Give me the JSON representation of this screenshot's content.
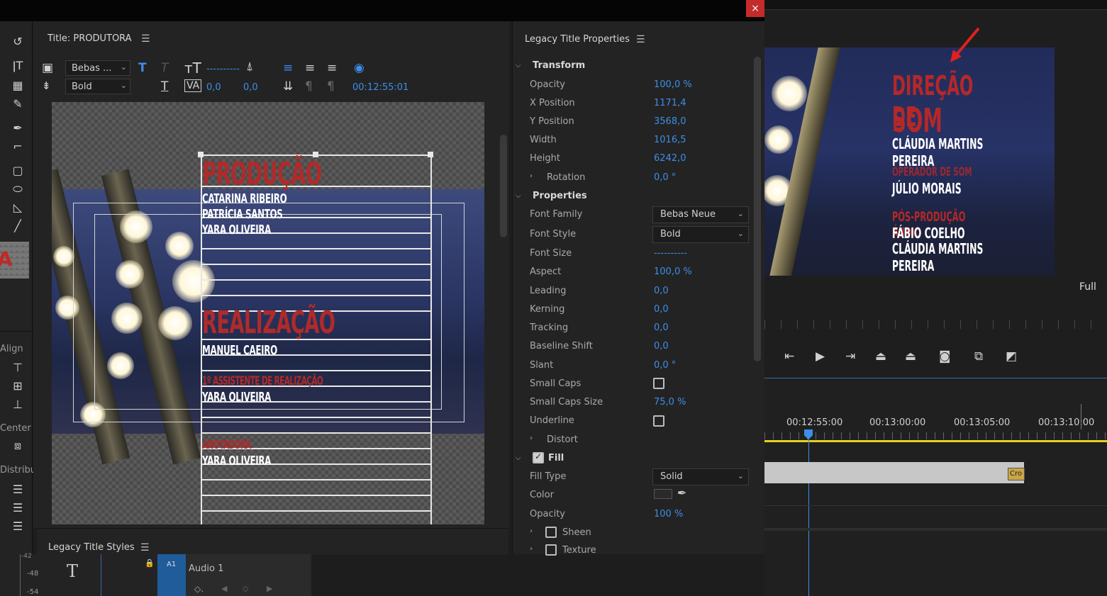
{
  "window": {
    "close_icon": "×"
  },
  "tools": {
    "labels": {
      "align": "Align",
      "center": "Center",
      "distribute": "Distribute"
    }
  },
  "title_panel": {
    "tab_label": "Title: PRODUTORA",
    "font_family_value": "Bebas ...",
    "font_style_value": "Bold",
    "font_size_value": "----------",
    "kerning_value": "0,0",
    "baseline_value": "0,0",
    "timecode": "00:12:55:01",
    "roll": {
      "h1": "PRODUÇÃO",
      "n1": "CATARINA RIBEIRO",
      "n2": "PATRÍCIA SANTOS",
      "n3": "YARA OLIVEIRA",
      "h2": "REALIZAÇÃO",
      "n4": "MANUEL CAEIRO",
      "h3": "1º ASSISTENTE DE REALIZAÇÃO",
      "n5": "YARA OLIVEIRA",
      "h4": "ANOTADORA",
      "n6": "YARA OLIVEIRA"
    }
  },
  "styles_panel": {
    "tab_label": "Legacy Title Styles"
  },
  "timeline_track": {
    "track_id": "A1",
    "track_name": "Audio 1",
    "meter_1": "-48",
    "meter_2": "-54",
    "meter_0": "-42"
  },
  "properties": {
    "tab_label": "Legacy Title Properties",
    "transform": {
      "label": "Transform",
      "opacity_label": "Opacity",
      "opacity_value": "100,0 %",
      "xpos_label": "X Position",
      "xpos_value": "1171,4",
      "ypos_label": "Y Position",
      "ypos_value": "3568,0",
      "width_label": "Width",
      "width_value": "1016,5",
      "height_label": "Height",
      "height_value": "6242,0",
      "rotation_label": "Rotation",
      "rotation_value": "0,0 °"
    },
    "props": {
      "label": "Properties",
      "font_family_label": "Font Family",
      "font_family_value": "Bebas Neue",
      "font_style_label": "Font Style",
      "font_style_value": "Bold",
      "font_size_label": "Font Size",
      "font_size_value": "----------",
      "aspect_label": "Aspect",
      "aspect_value": "100,0 %",
      "leading_label": "Leading",
      "leading_value": "0,0",
      "kerning_label": "Kerning",
      "kerning_value": "0,0",
      "tracking_label": "Tracking",
      "tracking_value": "0,0",
      "baseline_label": "Baseline Shift",
      "baseline_value": "0,0",
      "slant_label": "Slant",
      "slant_value": "0,0 °",
      "smallcaps_label": "Small Caps",
      "smallcaps_size_label": "Small Caps Size",
      "smallcaps_size_value": "75,0 %",
      "underline_label": "Underline",
      "distort_label": "Distort"
    },
    "fill": {
      "label": "Fill",
      "fill_type_label": "Fill Type",
      "fill_type_value": "Solid",
      "color_label": "Color",
      "opacity_label": "Opacity",
      "opacity_value": "100 %",
      "sheen_label": "Sheen",
      "texture_label": "Texture"
    }
  },
  "program_monitor": {
    "lines": {
      "h_partial": "DIREÇÃO DE",
      "h_som": "SOM",
      "n1": "CLÁUDIA MARTINS PEREIRA",
      "h_op": "OPERADOR DE SOM",
      "n2": "JÚLIO MORAIS",
      "h_pos": "PÓS-PRODUÇÃO ÁUDIO",
      "n3": "FÁBIO COELHO",
      "n4": "CLÁUDIA MARTINS PEREIRA"
    },
    "zoom": "Full"
  },
  "timeline": {
    "ticks": [
      "00:12:55:00",
      "00:13:00:00",
      "00:13:05:00",
      "00:13:10:00"
    ],
    "clip_label": "Cro"
  }
}
